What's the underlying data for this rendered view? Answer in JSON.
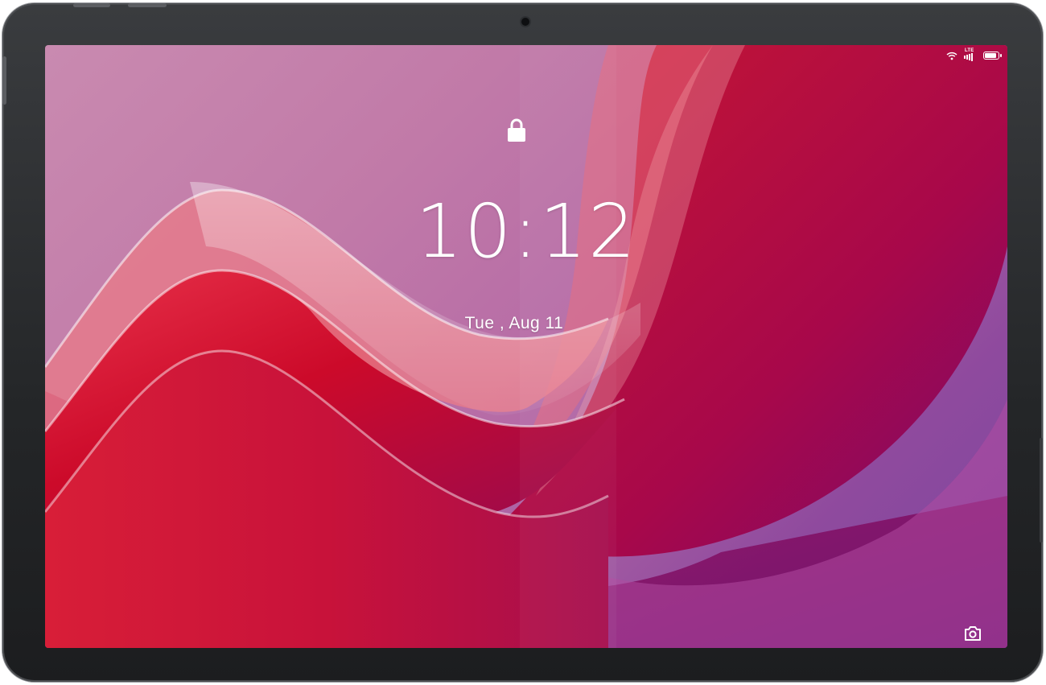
{
  "device": {
    "type": "tablet",
    "bezel_color": "#2a2c2f"
  },
  "status_bar": {
    "network_label": "LTE",
    "icons": [
      "wifi-icon",
      "lte-signal-icon",
      "battery-icon"
    ],
    "battery_level": 1.0
  },
  "lock_screen": {
    "lock_icon": "lock-icon",
    "time": "10:12",
    "date": "Tue , Aug  11",
    "shortcut_icon": "camera-icon"
  },
  "colors": {
    "accent_red": "#d0102c",
    "wallpaper_pink": "#c98ab0",
    "wallpaper_purple": "#7a46a0"
  }
}
